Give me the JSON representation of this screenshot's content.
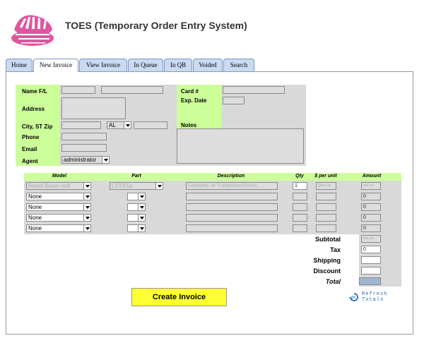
{
  "app": {
    "title": "TOES (Temporary Order Entry System)"
  },
  "tabs": [
    {
      "label": "Home"
    },
    {
      "label": "New Invoice",
      "active": true
    },
    {
      "label": "View Invoice"
    },
    {
      "label": "In Queue"
    },
    {
      "label": "In QB"
    },
    {
      "label": "Voided"
    },
    {
      "label": "Search"
    }
  ],
  "customer": {
    "name_label": "Name F/L",
    "address_label": "Address",
    "city_label": "City, ST Zip",
    "state_value": "AL",
    "phone_label": "Phone",
    "email_label": "Email",
    "agent_label": "Agent",
    "agent_value": "administrator",
    "card_label": "Card #",
    "exp_label": "Exp. Date",
    "notes_label": "Notes"
  },
  "items": {
    "headers": [
      "Model",
      "Part",
      "Description",
      "Qty",
      "$ per unit",
      "Amount"
    ],
    "rows": [
      {
        "model": "Rebel Boxer mdl",
        "part": "LSTR1a",
        "desc": "Lifestyles ‹dl Trampoline/Enclos...",
        "qty": "1",
        "unit": "$•••.••",
        "amount": "•••.••"
      },
      {
        "model": "None",
        "part": "",
        "desc": "",
        "qty": "",
        "unit": "",
        "amount": "0"
      },
      {
        "model": "None",
        "part": "",
        "desc": "",
        "qty": "",
        "unit": "",
        "amount": "0"
      },
      {
        "model": "None",
        "part": "",
        "desc": "",
        "qty": "",
        "unit": "",
        "amount": "0"
      },
      {
        "model": "None",
        "part": "",
        "desc": "",
        "qty": "",
        "unit": "",
        "amount": "0"
      }
    ]
  },
  "totals": {
    "subtotal_label": "Subtotal",
    "subtotal_value": "•••.••",
    "tax_label": "Tax",
    "tax_value": "0",
    "shipping_label": "Shipping",
    "shipping_value": "",
    "discount_label": "Discount",
    "discount_value": "",
    "total_label": "Total",
    "total_value": "•••.••"
  },
  "actions": {
    "create_label": "Create Invoice",
    "refresh_label_1": "Refresh",
    "refresh_label_2": "Totals"
  },
  "colors": {
    "green": "#ccff99",
    "gray": "#d9d9d9",
    "tab": "#c9daf3",
    "button": "#ffff33",
    "logo": "#e0559f"
  }
}
